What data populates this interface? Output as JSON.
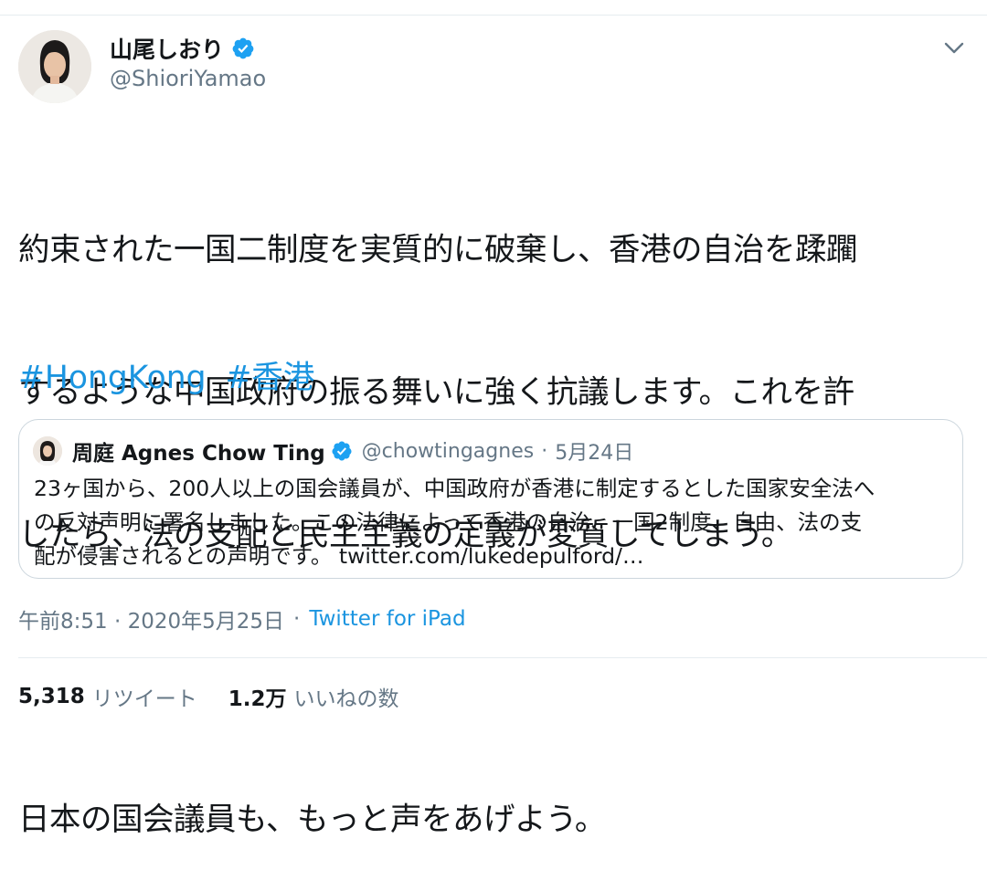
{
  "tweet": {
    "author": {
      "display_name": "山尾しおり",
      "handle": "@ShioriYamao",
      "verified": true
    },
    "text_lines": [
      "約束された一国二制度を実質的に破棄し、香港の自治を蹂躙",
      "するような中国政府の振る舞いに強く抗議します。これを許",
      "したら、法の支配と民主主義の定義が変質してしまう。",
      "",
      "日本の国会議員も、もっと声をあげよう。"
    ],
    "hashtags": [
      "#HongKong",
      "#香港"
    ],
    "timestamp": "午前8:51 · 2020年5月25日",
    "meta_separator": "·",
    "source": "Twitter for iPad",
    "stats": {
      "retweets_count": "5,318",
      "retweets_label": "リツイート",
      "likes_count": "1.2万",
      "likes_label": "いいねの数"
    }
  },
  "quoted_tweet": {
    "author": {
      "display_name": "周庭 Agnes Chow Ting",
      "handle": "@chowtingagnes",
      "verified": true
    },
    "separator": "·",
    "date": "5月24日",
    "text_lines": [
      "23ヶ国から、200人以上の国会議員が、中国政府が香港に制定するとした国家安全法へ",
      "の反対声明に署名しました。この法律によって香港の自治、一国2制度、自由、法の支",
      "配が侵害されるとの声明です。"
    ],
    "link": "twitter.com/lukedepulford/…"
  },
  "colors": {
    "accent": "#1b95e0",
    "verified": "#1da1f2",
    "text": "#14171a",
    "secondary": "#657786",
    "border": "#ccd6dd"
  },
  "icons": {
    "verified": "verified-badge-icon",
    "menu": "chevron-down-icon"
  }
}
